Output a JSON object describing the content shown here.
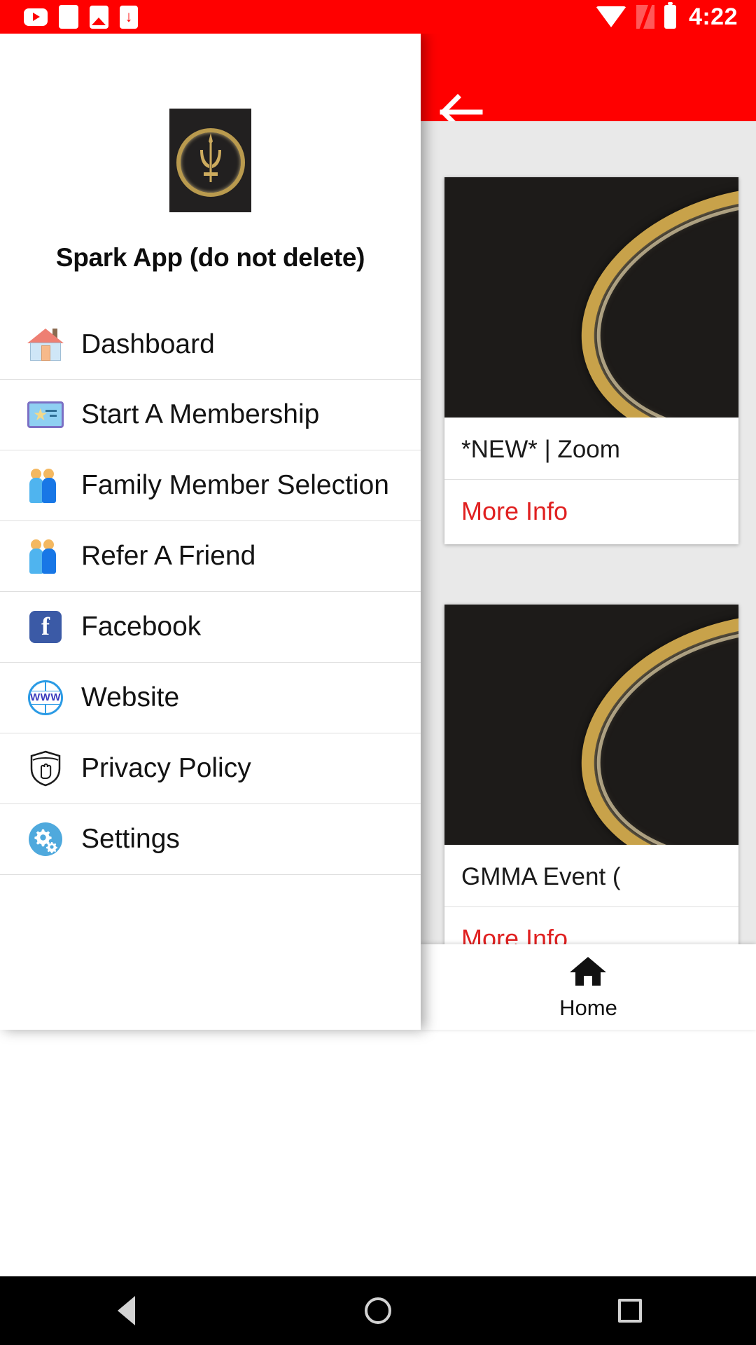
{
  "status_bar": {
    "time": "4:22",
    "background_color": "#FF0000",
    "left_icons": [
      "youtube-icon",
      "blank-notification-icon",
      "image-icon",
      "download-icon"
    ],
    "right_icons": [
      "wifi-icon",
      "signal-icon",
      "battery-icon"
    ]
  },
  "app_bar": {
    "background_color": "#FF0000",
    "back_icon": "back-arrow-icon"
  },
  "drawer": {
    "logo": "spark-trident-logo",
    "title": "Spark App (do not delete)",
    "items": [
      {
        "label": "Dashboard",
        "icon": "house-icon"
      },
      {
        "label": "Start A Membership",
        "icon": "ticket-icon"
      },
      {
        "label": "Family Member Selection",
        "icon": "two-people-icon"
      },
      {
        "label": "Refer A Friend",
        "icon": "two-people-icon"
      },
      {
        "label": "Facebook",
        "icon": "facebook-icon"
      },
      {
        "label": "Website",
        "icon": "globe-www-icon"
      },
      {
        "label": "Privacy Policy",
        "icon": "shield-hand-icon"
      },
      {
        "label": "Settings",
        "icon": "gears-icon"
      }
    ]
  },
  "content": {
    "background_color": "#e9e9e9",
    "action_color": "#e02020",
    "cards": [
      {
        "title": "*NEW* | Zoom",
        "action": "More Info",
        "image": "gold-bangle-on-black-photo"
      },
      {
        "title": "GMMA Event (",
        "action": "More Info",
        "image": "gold-bangle-on-black-photo"
      }
    ]
  },
  "bottom_nav": {
    "items": [
      {
        "label": "Home",
        "icon": "home-icon"
      }
    ]
  },
  "system_nav": {
    "items": [
      "back-triangle-icon",
      "home-circle-icon",
      "recents-square-icon"
    ]
  }
}
